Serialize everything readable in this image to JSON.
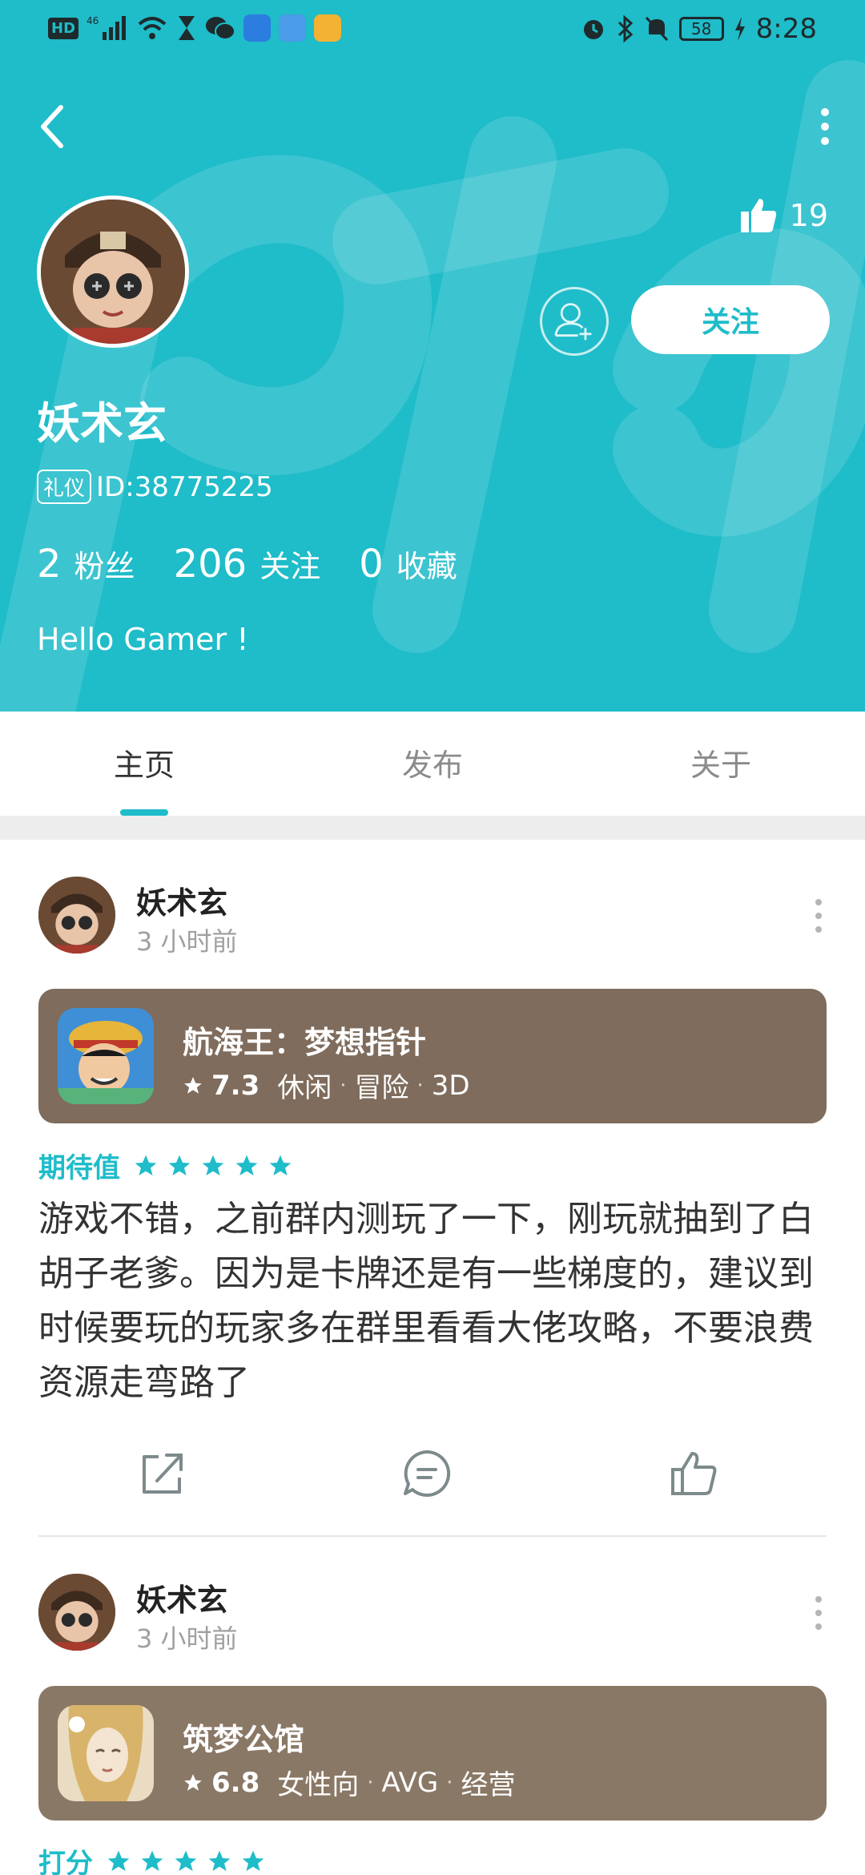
{
  "statusbar": {
    "network": "46",
    "battery": "58",
    "time": "8:28"
  },
  "profile": {
    "likes": "19",
    "follow_label": "关注",
    "username": "妖术玄",
    "badge": "礼仪",
    "id_text": "ID:38775225",
    "stats": [
      {
        "value": "2",
        "label": "粉丝"
      },
      {
        "value": "206",
        "label": "关注"
      },
      {
        "value": "0",
        "label": "收藏"
      }
    ],
    "bio": "Hello Gamer !"
  },
  "tabs": [
    {
      "label": "主页",
      "active": true
    },
    {
      "label": "发布",
      "active": false
    },
    {
      "label": "关于",
      "active": false
    }
  ],
  "posts": [
    {
      "author": "妖术玄",
      "time": "3 小时前",
      "game": {
        "title": "航海王：梦想指针",
        "score": "7.3",
        "tags": [
          "休闲",
          "冒险",
          "3D"
        ]
      },
      "rating_label": "期待值",
      "stars": 5,
      "text": "游戏不错，之前群内测玩了一下，刚玩就抽到了白胡子老爹。因为是卡牌还是有一些梯度的，建议到时候要玩的玩家多在群里看看大佬攻略，不要浪费资源走弯路了"
    },
    {
      "author": "妖术玄",
      "time": "3 小时前",
      "game": {
        "title": "筑梦公馆",
        "score": "6.8",
        "tags": [
          "女性向",
          "AVG",
          "经营"
        ]
      },
      "rating_label": "打分",
      "stars": 5
    }
  ],
  "colors": {
    "accent": "#1fbcc9",
    "card": "#7f6c5c"
  }
}
